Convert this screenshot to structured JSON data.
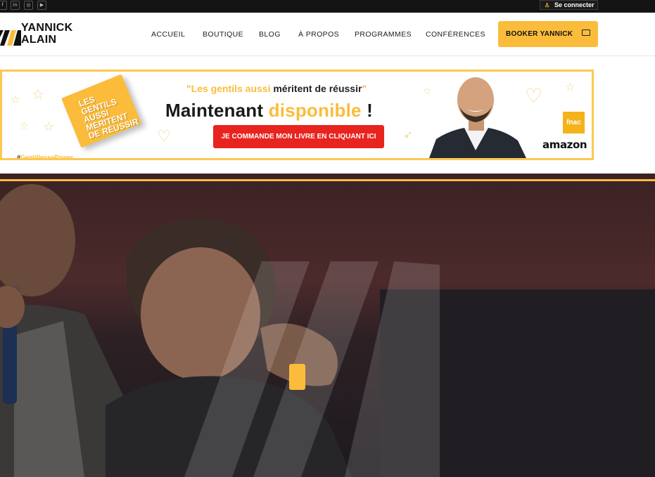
{
  "topbar": {
    "social_icons": [
      {
        "name": "facebook-icon",
        "glyph": "f"
      },
      {
        "name": "linkedin-icon",
        "glyph": "in"
      },
      {
        "name": "instagram-icon",
        "glyph": "◎"
      },
      {
        "name": "youtube-icon",
        "glyph": "▶"
      }
    ],
    "login_label": "Se connecter",
    "login_icon": "user-icon"
  },
  "header": {
    "logo_line1": "YANNICK",
    "logo_line2": "ALAIN",
    "nav": [
      {
        "label": "ACCUEIL"
      },
      {
        "label": "BOUTIQUE"
      },
      {
        "label": "BLOG"
      },
      {
        "label": "À PROPOS"
      },
      {
        "label": "PROGRAMMES"
      },
      {
        "label": "CONFÉRENCES"
      }
    ],
    "booker_label": "BOOKER YANNICK",
    "booker_icon": "ticket-icon"
  },
  "banner": {
    "book_title": "LES GENTILS AUSSI MÉRITENT DE RÉUSSIR",
    "quote_open": "\"",
    "quote_highlight": "Les gentils aussi",
    "quote_rest": " méritent de réussir",
    "quote_close": "\"",
    "headline_main": "Maintenant ",
    "headline_highlight": "disponible",
    "headline_end": " !",
    "button_label": "JE COMMANDE MON LIVRE EN CLIQUANT ICI",
    "hashtag_symbol": "#",
    "hashtag_text": "GentillessePower",
    "fnac_label": "fnac",
    "amazon_label": "amazon"
  },
  "hero": {
    "accent_color": "#fbbc3b",
    "play_icon": "play-icon"
  },
  "colors": {
    "brand_yellow": "#fbbc3b",
    "cta_red": "#e8241f",
    "topbar_bg": "#141414"
  }
}
